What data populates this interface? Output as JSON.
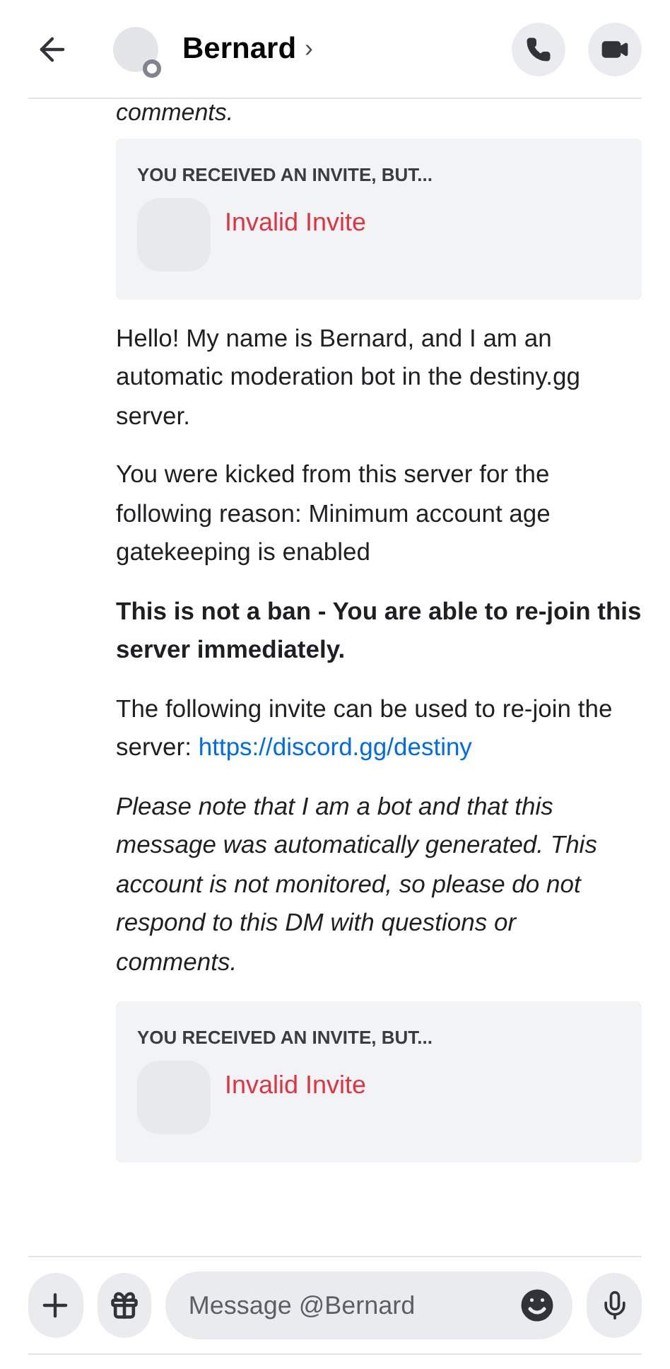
{
  "header": {
    "name": "Bernard",
    "chevron": "›"
  },
  "blocks": [
    {
      "kind": "cut",
      "text": "comments."
    },
    {
      "kind": "invite",
      "heading": "YOU RECEIVED AN INVITE, BUT...",
      "status": "Invalid Invite"
    },
    {
      "kind": "text",
      "text": "Hello! My name is Bernard, and I am an automatic moderation bot in the destiny.gg server."
    },
    {
      "kind": "text",
      "text": "You were kicked from this server for the following reason: Minimum account age gatekeeping is enabled"
    },
    {
      "kind": "bold",
      "text": "This is not a ban - You are able to re-join this server immediately."
    },
    {
      "kind": "link",
      "text": "The following invite can be used to re-join the server:",
      "link": "https://discord.gg/destiny"
    },
    {
      "kind": "italic",
      "text": "Please note that I am a bot and that this message was automatically generated. This account is not monitored, so please do not respond to this DM with questions or comments."
    },
    {
      "kind": "invite",
      "heading": "YOU RECEIVED AN INVITE, BUT...",
      "status": "Invalid Invite"
    }
  ],
  "composer": {
    "placeholder": "Message @Bernard"
  }
}
